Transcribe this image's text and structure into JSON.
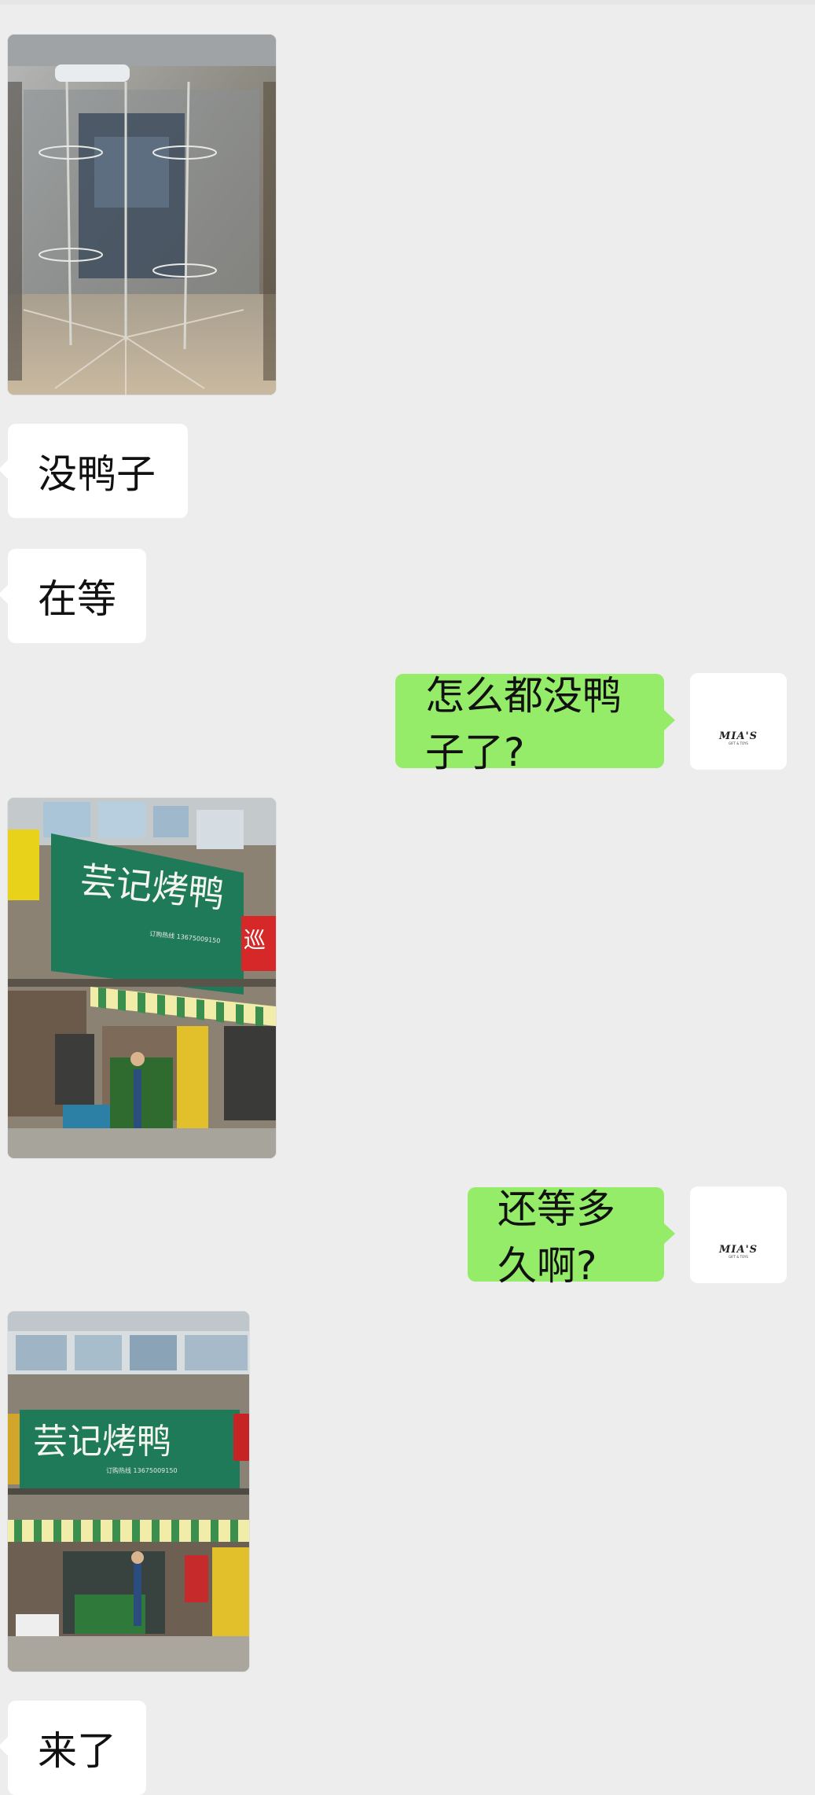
{
  "messages": [
    {
      "side": "left",
      "type": "image",
      "caption": "photo-rotisserie-oven"
    },
    {
      "side": "left",
      "type": "text",
      "text": "没鸭子"
    },
    {
      "side": "left",
      "type": "text",
      "text": "在等"
    },
    {
      "side": "right",
      "type": "text",
      "text": "怎么都没鸭子了?"
    },
    {
      "side": "left",
      "type": "image",
      "caption": "photo-storefront"
    },
    {
      "side": "right",
      "type": "text",
      "text": "还等多久啊?"
    },
    {
      "side": "left",
      "type": "image",
      "caption": "photo-storefront-2"
    },
    {
      "side": "left",
      "type": "text",
      "text": "来了"
    }
  ],
  "avatar": {
    "logo_text": "MIA'S",
    "sub_text": "GIFT & TOYS"
  },
  "shop_sign": {
    "name": "芸记烤鸭",
    "subtext": "订购热线 13675009150",
    "side_sign": "巡"
  },
  "colors": {
    "background": "#ededed",
    "incoming_bubble": "#ffffff",
    "outgoing_bubble": "#95ec69",
    "sign_green": "#1e7a58"
  }
}
